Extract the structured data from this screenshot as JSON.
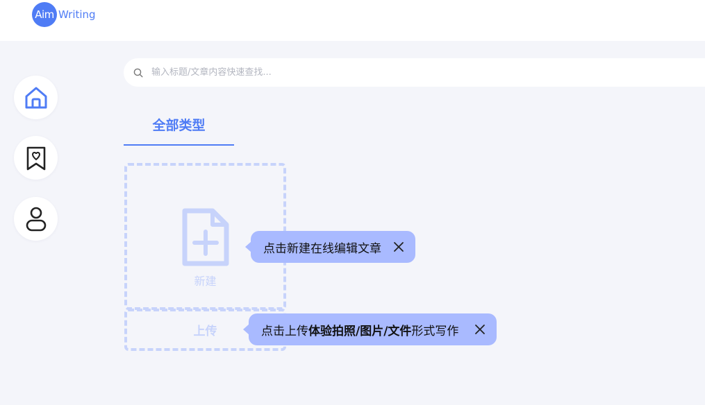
{
  "brand": {
    "logo_circle": "Aim",
    "logo_text": "Writing",
    "accent": "#4f7cf5"
  },
  "sidebar": [
    {
      "icon": "home-icon"
    },
    {
      "icon": "bookmark-heart-icon"
    },
    {
      "icon": "user-icon"
    }
  ],
  "search": {
    "placeholder": "输入标题/文章内容快速查找..."
  },
  "tabs": [
    {
      "label": "全部类型",
      "active": true
    }
  ],
  "cards": {
    "new_label": "新建",
    "upload_label": "上传"
  },
  "tips": {
    "new_tip": "点击新建在线编辑文章",
    "upload_prefix": "点击上传",
    "upload_bold": "体验拍照/图片/文件",
    "upload_suffix": "形式写作"
  },
  "colors": {
    "background": "#f4f5fa",
    "dashed_border": "#c7d3fb",
    "tip_bg": "#a9baff"
  }
}
